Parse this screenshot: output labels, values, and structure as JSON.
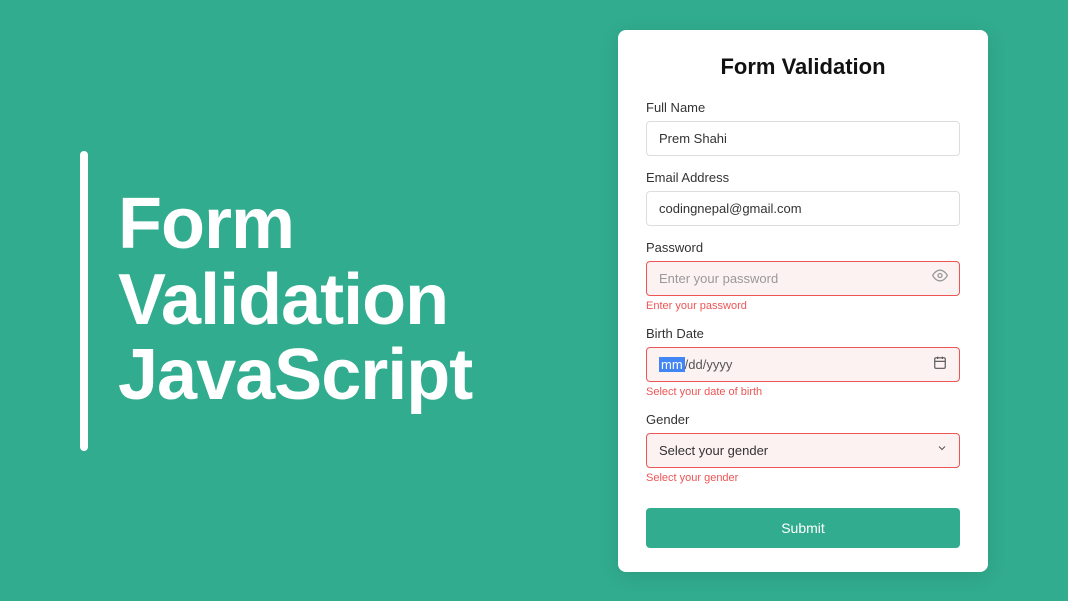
{
  "hero": {
    "line1": "Form",
    "line2": "Validation",
    "line3": "JavaScript"
  },
  "form": {
    "title": "Form Validation",
    "fullName": {
      "label": "Full Name",
      "value": "Prem Shahi"
    },
    "email": {
      "label": "Email Address",
      "value": "codingnepal@gmail.com"
    },
    "password": {
      "label": "Password",
      "placeholder": "Enter your password",
      "error": "Enter your password"
    },
    "birthDate": {
      "label": "Birth Date",
      "mm": "mm",
      "rest": "/dd/yyyy",
      "error": "Select your date of birth"
    },
    "gender": {
      "label": "Gender",
      "selected": "Select your gender",
      "error": "Select your gender"
    },
    "submit": "Submit"
  }
}
